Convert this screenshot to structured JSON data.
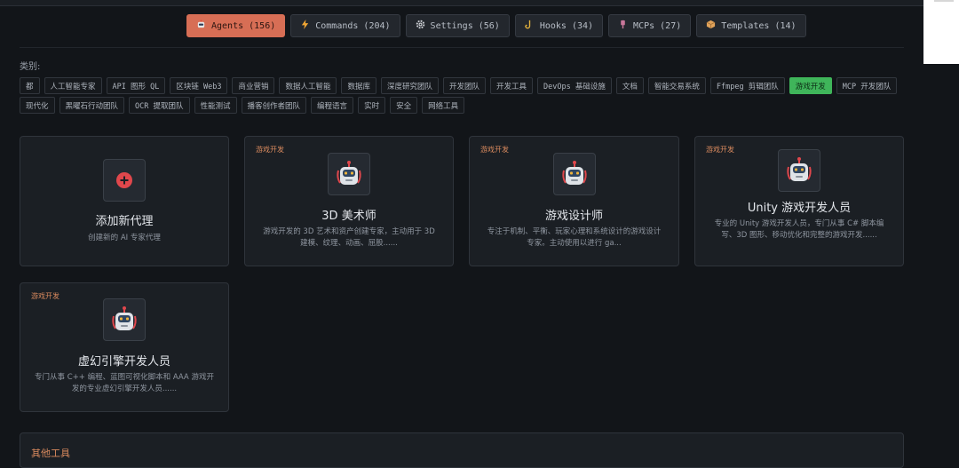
{
  "tabs": [
    {
      "label": "Agents (156)",
      "icon": "robot-icon",
      "active": true
    },
    {
      "label": "Commands (204)",
      "icon": "lightning-icon",
      "active": false
    },
    {
      "label": "Settings (56)",
      "icon": "gear-icon",
      "active": false
    },
    {
      "label": "Hooks (34)",
      "icon": "hook-icon",
      "active": false
    },
    {
      "label": "MCPs (27)",
      "icon": "plug-icon",
      "active": false
    },
    {
      "label": "Templates (14)",
      "icon": "package-icon",
      "active": false
    }
  ],
  "filters": {
    "label": "类别:",
    "chips": [
      "都",
      "人工智能专家",
      "API 图形 QL",
      "区块链 Web3",
      "商业营销",
      "数据人工智能",
      "数据库",
      "深度研究团队",
      "开发团队",
      "开发工具",
      "DevOps 基础设施",
      "文档",
      "智能交易系统",
      "Ffmpeg 剪辑团队",
      "游戏开发",
      "MCP 开发团队",
      "现代化",
      "黑曜石行动团队",
      "OCR 提取团队",
      "性能测试",
      "播客创作者团队",
      "编程语言",
      "实时",
      "安全",
      "网络工具"
    ],
    "active": "游戏开发"
  },
  "add_card": {
    "title": "添加新代理",
    "desc": "创建新的 AI 专家代理"
  },
  "agents": [
    {
      "tag": "游戏开发",
      "title": "3D 美术师",
      "desc": "游戏开发的 3D 艺术和资产创建专家，主动用于 3D 建模、纹理、动画、屈股......"
    },
    {
      "tag": "游戏开发",
      "title": "游戏设计师",
      "desc": "专注于机制、平衡、玩家心理和系统设计的游戏设计专家。主动使用以进行 ga..."
    },
    {
      "tag": "游戏开发",
      "title": "Unity 游戏开发人员",
      "desc": "专业的 Unity 游戏开发人员，专门从事 C# 脚本编写、3D 图形、移动优化和完整的游戏开发......"
    },
    {
      "tag": "游戏开发",
      "title": "虚幻引擎开发人员",
      "desc": "专门从事 C++ 编程、蓝图可视化脚本和 AAA 游戏开发的专业虚幻引擎开发人员......"
    }
  ],
  "bottom_partial": "其他工具",
  "colors": {
    "accent": "#d76e55",
    "active_chip": "#3fb55a",
    "tag": "#d98a5e",
    "background": "#121519",
    "card": "#1b1f24"
  }
}
